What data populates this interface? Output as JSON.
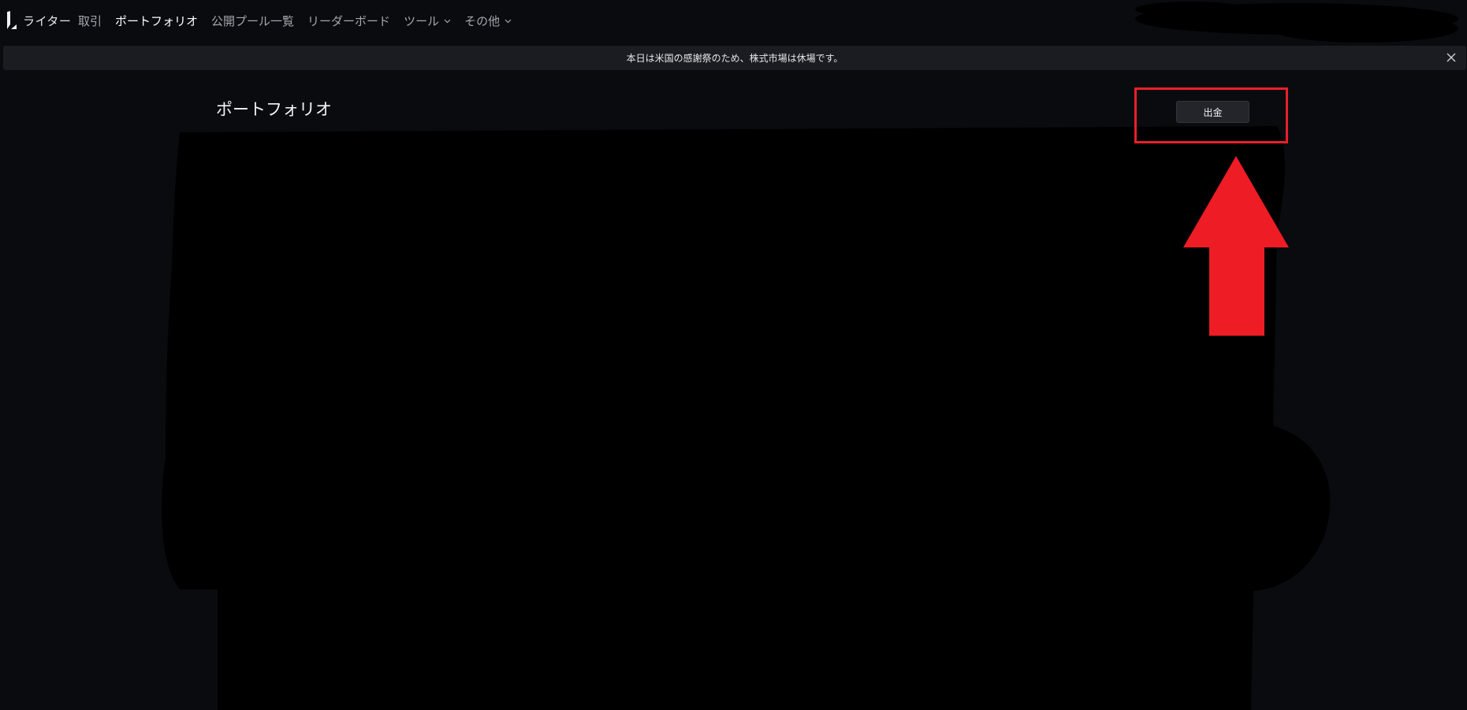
{
  "brand": {
    "name": "ライター"
  },
  "nav": {
    "items": [
      {
        "label": "取引",
        "active": false,
        "dropdown": false
      },
      {
        "label": "ポートフォリオ",
        "active": true,
        "dropdown": false
      },
      {
        "label": "公開プール一覧",
        "active": false,
        "dropdown": false
      },
      {
        "label": "リーダーボード",
        "active": false,
        "dropdown": false
      },
      {
        "label": "ツール",
        "active": false,
        "dropdown": true
      },
      {
        "label": "その他",
        "active": false,
        "dropdown": true
      }
    ]
  },
  "banner": {
    "text": "本日は米国の感謝祭のため、株式市場は休場です。"
  },
  "page": {
    "title": "ポートフォリオ",
    "withdraw_label": "出金"
  },
  "colors": {
    "background": "#0a0b0f",
    "banner": "#1b1c21",
    "highlight": "#e8202a"
  },
  "icons": [
    "lighter-logo-icon",
    "chevron-down-icon",
    "close-icon",
    "red-up-arrow-icon"
  ]
}
